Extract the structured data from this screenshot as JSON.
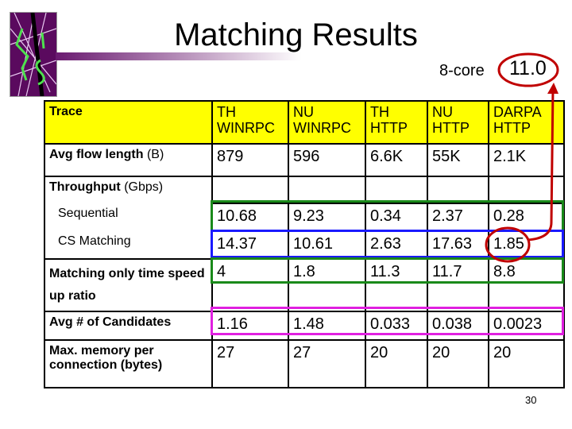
{
  "title": "Matching Results",
  "annotation": {
    "core_label": "8-core",
    "core_value": "11.0"
  },
  "table": {
    "header": {
      "label": "Trace",
      "columns": [
        "TH WINRPC",
        "NU WINRPC",
        "TH HTTP",
        "NU HTTP",
        "DARPA HTTP"
      ]
    },
    "rows": [
      {
        "label": "Avg flow length",
        "unit": "(B)",
        "values": [
          "879",
          "596",
          "6.6K",
          "55K",
          "2.1K"
        ]
      },
      {
        "label": "Throughput",
        "unit": "(Gbps)",
        "values": [
          "",
          "",
          "",
          "",
          ""
        ]
      },
      {
        "label": "Sequential",
        "values": [
          "10.68",
          "9.23",
          "0.34",
          "2.37",
          "0.28"
        ]
      },
      {
        "label": "CS Matching",
        "values": [
          "14.37",
          "10.61",
          "2.63",
          "17.63",
          "1.85"
        ]
      },
      {
        "label": "Matching only time speed up ratio",
        "values": [
          "4",
          "1.8",
          "11.3",
          "11.7",
          "8.8"
        ]
      },
      {
        "label": "Avg # of Candidates",
        "values": [
          "1.16",
          "1.48",
          "0.033",
          "0.038",
          "0.0023"
        ]
      },
      {
        "label": "Max. memory per connection (bytes)",
        "values": [
          "27",
          "27",
          "20",
          "20",
          "20"
        ]
      }
    ]
  },
  "highlight_colors": {
    "header": "#ffff00",
    "sequential": "#1a8a1a",
    "cs_matching": "#1a1aff",
    "speedup": "#1a8a1a",
    "candidates": "#e020e0",
    "annotation": "#c00000"
  },
  "page_number": "30"
}
